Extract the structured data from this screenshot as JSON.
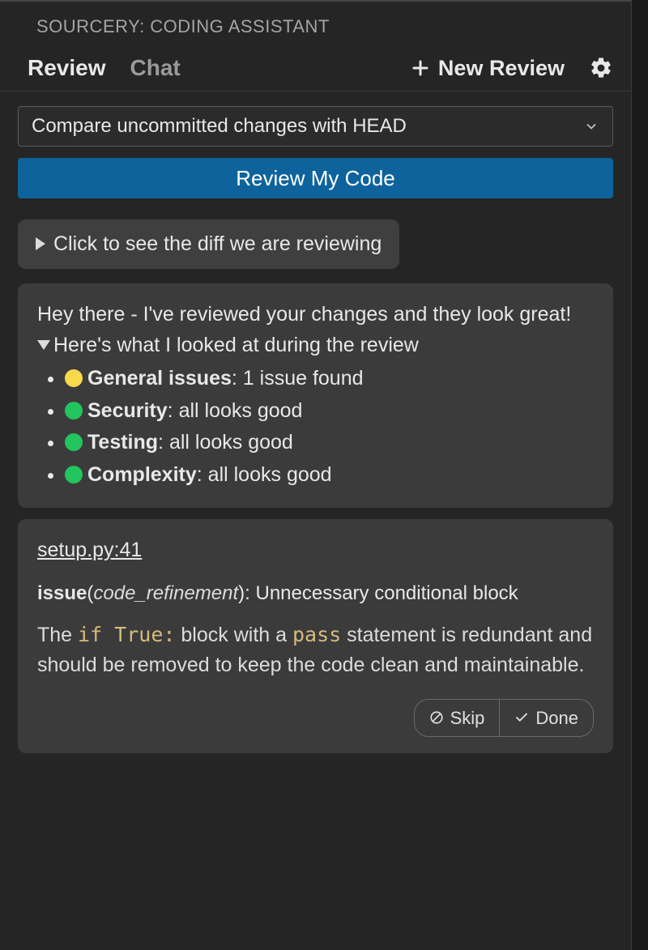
{
  "panel": {
    "title": "SOURCERY: CODING ASSISTANT"
  },
  "tabs": {
    "review": "Review",
    "chat": "Chat",
    "active": "review"
  },
  "toolbar": {
    "new_review_label": "New Review",
    "gear_label": "Settings"
  },
  "dropdown": {
    "selected": "Compare uncommitted changes with HEAD"
  },
  "primary_button": "Review My Code",
  "disclosure": {
    "label": "Click to see the diff we are reviewing"
  },
  "summary": {
    "intro": "Hey there - I've reviewed your changes and they look great!",
    "expand_label": "Here's what I looked at during the review",
    "items": [
      {
        "color": "yellow",
        "label": "General issues",
        "value": "1 issue found"
      },
      {
        "color": "green",
        "label": "Security",
        "value": "all looks good"
      },
      {
        "color": "green",
        "label": "Testing",
        "value": "all looks good"
      },
      {
        "color": "green",
        "label": "Complexity",
        "value": "all looks good"
      }
    ]
  },
  "issue": {
    "file_ref": "setup.py:41",
    "kind": "issue",
    "category": "code_refinement",
    "title": "Unnecessary conditional block",
    "body_pre": "The ",
    "code1": "if True:",
    "body_mid": " block with a ",
    "code2": "pass",
    "body_post": " statement is redundant and should be removed to keep the code clean and maintainable.",
    "actions": {
      "skip": "Skip",
      "done": "Done"
    }
  }
}
